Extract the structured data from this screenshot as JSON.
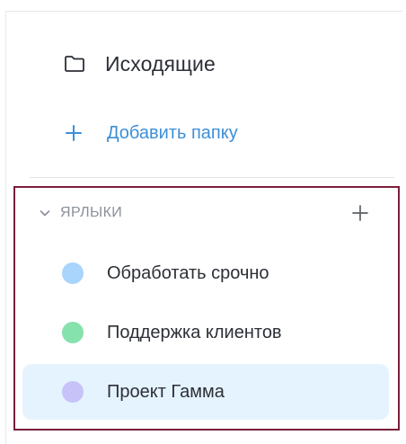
{
  "folders": {
    "items": [
      {
        "label": "Исходящие",
        "icon": "folder-icon"
      }
    ],
    "add_label": "Добавить папку",
    "add_icon": "plus-icon"
  },
  "labels": {
    "title": "ЯРЛЫКИ",
    "expanded": true,
    "toggle_icon": "chevron-down-icon",
    "add_icon": "plus-icon",
    "items": [
      {
        "label": "Обработать срочно",
        "color": "#a9d4fb",
        "active": false
      },
      {
        "label": "Поддержка клиентов",
        "color": "#86e2ad",
        "active": false
      },
      {
        "label": "Проект Гамма",
        "color": "#c7c2f7",
        "active": true
      }
    ]
  },
  "colors": {
    "accent": "#3d8fd8",
    "selected_background": "#e5f3ff",
    "highlight_border": "#7a1e3a"
  }
}
